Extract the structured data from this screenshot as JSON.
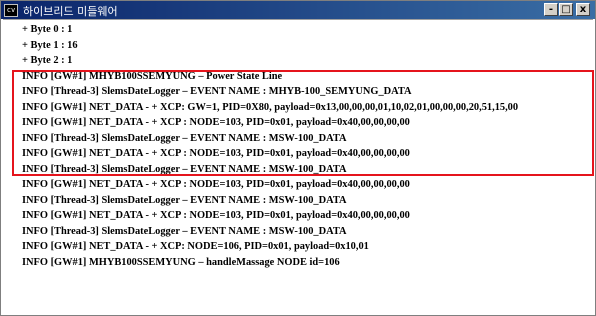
{
  "window": {
    "title": "하이브리드 미들웨어",
    "icon": "console-app-icon",
    "icon_text": "cv",
    "controls": {
      "minimize": "-",
      "maximize": "□",
      "close": "x"
    }
  },
  "console": {
    "lines": [
      "+ Byte 0 : 1",
      "+ Byte 1 : 16",
      "+ Byte 2 : 1",
      "INFO [GW#1] MHYB100SSEMYUNG  – Power State Line",
      "INFO [Thread-3] SlemsDateLogger – EVENT NAME : MHYB-100_SEMYUNG_DATA",
      "INFO [GW#1] NET_DATA - + XCP: GW=1, PID=0X80, payload=0x13,00,00,00,01,10,02,01,00,00,00,20,51,15,00",
      "INFO [GW#1] NET_DATA - + XCP : NODE=103, PID=0x01, payload=0x40,00,00,00,00",
      "INFO [Thread-3] SlemsDateLogger – EVENT NAME : MSW-100_DATA",
      "INFO [GW#1] NET_DATA - + XCP : NODE=103, PID=0x01, payload=0x40,00,00,00,00",
      "INFO [Thread-3] SlemsDateLogger – EVENT NAME : MSW-100_DATA",
      "INFO [GW#1] NET_DATA - + XCP : NODE=103, PID=0x01, payload=0x40,00,00,00,00",
      "INFO [Thread-3] SlemsDateLogger – EVENT NAME : MSW-100_DATA",
      "INFO [GW#1] NET_DATA - + XCP : NODE=103, PID=0x01, payload=0x40,00,00,00,00",
      "INFO [Thread-3] SlemsDateLogger – EVENT NAME : MSW-100_DATA",
      "INFO [GW#1] NET_DATA - + XCP: NODE=106, PID=0x01, payload=0x10,01",
      "INFO [GW#1] MHYB100SSEMYUNG  – handleMassage NODE id=106"
    ]
  },
  "highlight": {
    "color": "#e5141c",
    "first_line": 3,
    "last_line": 7
  },
  "colors": {
    "titlebar_start": "#0a246a",
    "titlebar_end": "#3a6ea5",
    "text": "#000000"
  }
}
